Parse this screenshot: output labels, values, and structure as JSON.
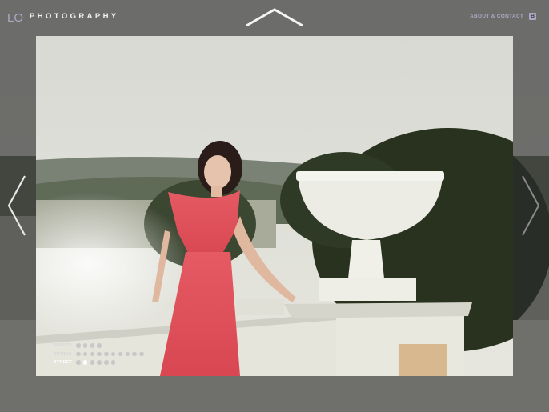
{
  "header": {
    "logo_mark": "LO",
    "logo_text": "PHOTOGRAPHY",
    "about_link": "ABOUT & CONTACT",
    "badge_icon": "b-icon",
    "b_icon_glyph": "B"
  },
  "navigation": {
    "up_icon": "chevron-up-icon",
    "prev_icon": "chevron-left-icon",
    "next_icon": "chevron-right-icon"
  },
  "categories": [
    {
      "label": "BEAUTY",
      "dots": 4,
      "current": -1,
      "active": false
    },
    {
      "label": "STUDIO",
      "dots": 10,
      "current": -1,
      "active": false
    },
    {
      "label": "STREET",
      "dots": 6,
      "current": 1,
      "active": true
    }
  ],
  "colors": {
    "accent": "#a9a9c4",
    "dress": "#e0505a",
    "background": "#3b3c3c"
  }
}
